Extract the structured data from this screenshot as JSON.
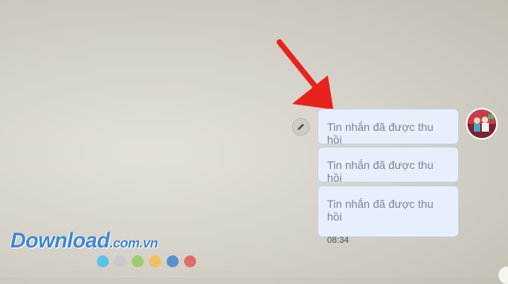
{
  "messages": [
    {
      "text": "Tin nhắn đã được thu hồi"
    },
    {
      "text": "Tin nhắn đã được thu hồi"
    },
    {
      "text": "Tin nhắn đã được thu hồi",
      "time": "08:34"
    }
  ],
  "icons": {
    "edit": "pencil-icon",
    "avatar": "user-avatar",
    "annotation": "red-arrow"
  },
  "watermark": {
    "brand": "Download",
    "domain": ".com.vn",
    "dot_colors": [
      "#5bc2e7",
      "#c9c9c9",
      "#9ccf6b",
      "#f2c062",
      "#5b8fcb",
      "#e26a6a"
    ]
  },
  "colors": {
    "bubble_bg": "#e8effc",
    "bubble_border": "#c9d3e4",
    "bubble_text": "#7e8490",
    "arrow": "#e8221c",
    "logo": "#3f86cf"
  }
}
